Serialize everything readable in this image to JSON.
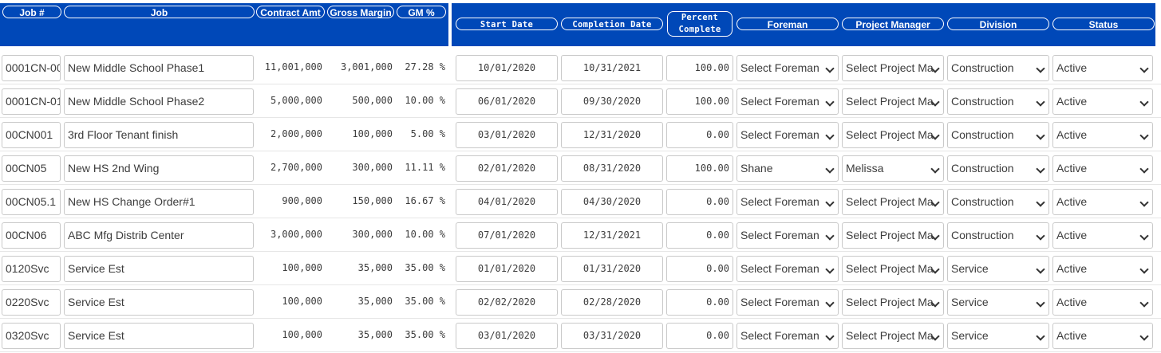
{
  "headers": {
    "job_no": "Job #",
    "job": "Job",
    "contract_amt": "Contract Amt",
    "gross_margin": "Gross Margin",
    "gm_pct": "GM %",
    "start_date": "Start Date",
    "completion_date": "Completion Date",
    "percent_complete": "Percent Complete",
    "foreman": "Foreman",
    "project_manager": "Project Manager",
    "division": "Division",
    "status": "Status"
  },
  "colors": {
    "header_bg": "#0048b8",
    "header_text": "#ffffff"
  },
  "rows": [
    {
      "job_no": "0001CN-00",
      "job": "New Middle School Phase1",
      "contract": "11,001,000",
      "margin": "3,001,000",
      "gm": "27.28 %",
      "start": "10/01/2020",
      "completion": "10/31/2021",
      "percent": "100.00",
      "foreman": "Select Foreman",
      "pm": "Select Project Ma",
      "division": "Construction",
      "status": "Active"
    },
    {
      "job_no": "0001CN-01",
      "job": "New Middle School Phase2",
      "contract": "5,000,000",
      "margin": "500,000",
      "gm": "10.00 %",
      "start": "06/01/2020",
      "completion": "09/30/2020",
      "percent": "100.00",
      "foreman": "Select Foreman",
      "pm": "Select Project Ma",
      "division": "Construction",
      "status": "Active"
    },
    {
      "job_no": "00CN001",
      "job": "3rd Floor Tenant finish",
      "contract": "2,000,000",
      "margin": "100,000",
      "gm": "5.00 %",
      "start": "03/01/2020",
      "completion": "12/31/2020",
      "percent": "0.00",
      "foreman": "Select Foreman",
      "pm": "Select Project Ma",
      "division": "Construction",
      "status": "Active"
    },
    {
      "job_no": "00CN05",
      "job": "New HS 2nd Wing",
      "contract": "2,700,000",
      "margin": "300,000",
      "gm": "11.11 %",
      "start": "02/01/2020",
      "completion": "08/31/2020",
      "percent": "100.00",
      "foreman": "Shane",
      "pm": "Melissa",
      "division": "Construction",
      "status": "Active"
    },
    {
      "job_no": "00CN05.1",
      "job": "New HS Change Order#1",
      "contract": "900,000",
      "margin": "150,000",
      "gm": "16.67 %",
      "start": "04/01/2020",
      "completion": "04/30/2020",
      "percent": "0.00",
      "foreman": "Select Foreman",
      "pm": "Select Project Ma",
      "division": "Construction",
      "status": "Active"
    },
    {
      "job_no": "00CN06",
      "job": "ABC Mfg Distrib Center",
      "contract": "3,000,000",
      "margin": "300,000",
      "gm": "10.00 %",
      "start": "07/01/2020",
      "completion": "12/31/2021",
      "percent": "0.00",
      "foreman": "Select Foreman",
      "pm": "Select Project Ma",
      "division": "Construction",
      "status": "Active"
    },
    {
      "job_no": "0120Svc",
      "job": "Service Est",
      "contract": "100,000",
      "margin": "35,000",
      "gm": "35.00 %",
      "start": "01/01/2020",
      "completion": "01/31/2020",
      "percent": "0.00",
      "foreman": "Select Foreman",
      "pm": "Select Project Ma",
      "division": "Service",
      "status": "Active"
    },
    {
      "job_no": "0220Svc",
      "job": "Service Est",
      "contract": "100,000",
      "margin": "35,000",
      "gm": "35.00 %",
      "start": "02/02/2020",
      "completion": "02/28/2020",
      "percent": "0.00",
      "foreman": "Select Foreman",
      "pm": "Select Project Ma",
      "division": "Service",
      "status": "Active"
    },
    {
      "job_no": "0320Svc",
      "job": "Service Est",
      "contract": "100,000",
      "margin": "35,000",
      "gm": "35.00 %",
      "start": "03/01/2020",
      "completion": "03/31/2020",
      "percent": "0.00",
      "foreman": "Select Foreman",
      "pm": "Select Project Ma",
      "division": "Service",
      "status": "Active"
    }
  ]
}
